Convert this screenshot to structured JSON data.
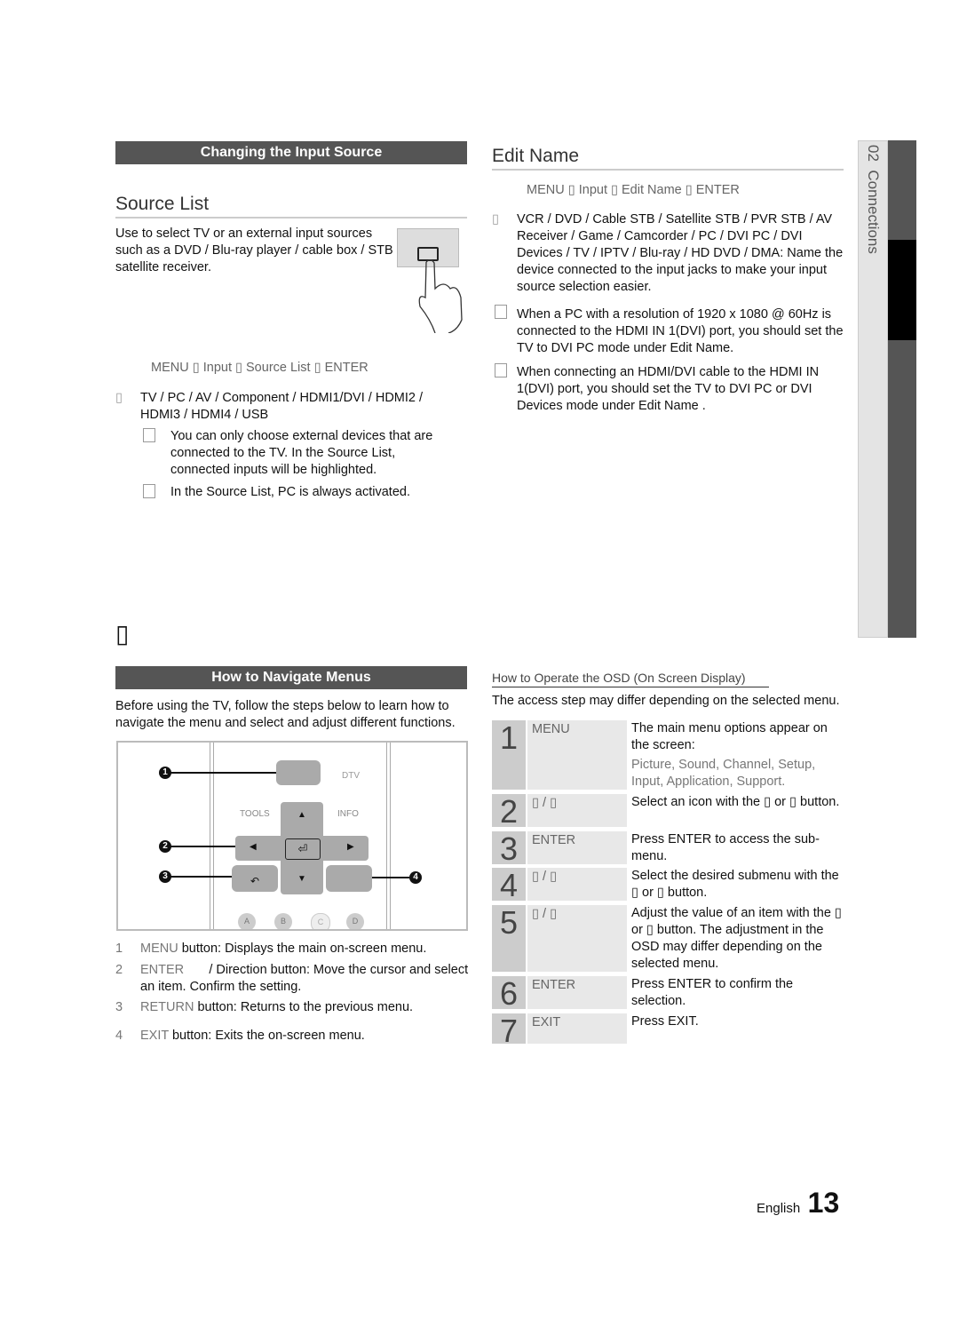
{
  "left": {
    "bar1": "Changing the Input Source",
    "source_list_title": "Source List",
    "source_intro": "Use to select TV or an external input sources such as a DVD / Blu-ray player / cable box / STB satellite receiver.",
    "source_path": "MENU      ▯ Input ▯  Source List ▯  ENTER",
    "source_items": "TV / PC / AV / Component / HDMI1/DVI / HDMI2 / HDMI3 / HDMI4 / USB",
    "note1": "You can only choose external devices that are connected to the TV. In the Source List, connected inputs will be highlighted.",
    "note2": "In the Source List, PC is always activated.",
    "section_mark": "▯",
    "bar2": "How to Navigate Menus",
    "nav_intro": "Before using the TV, follow the steps below to learn how to navigate the menu and select and adjust different functions.",
    "remote_labels": {
      "tools": "TOOLS",
      "info": "INFO",
      "dtv": "DTV",
      "c1": "1",
      "c2": "2",
      "c3": "3",
      "c4": "4",
      "a": "A",
      "b": "B",
      "c": "C",
      "d": "D"
    },
    "legend": [
      {
        "n": "1",
        "key": "MENU",
        "text": " button: Displays the main on-screen menu."
      },
      {
        "n": "2",
        "key": "ENTER",
        "text": "       / Direction button: Move the cursor and select an item. Confirm the setting."
      },
      {
        "n": "3",
        "key": "RETURN",
        "text": " button: Returns to the previous menu."
      },
      {
        "n": "4",
        "key": "EXIT",
        "text": " button: Exits the on-screen menu."
      }
    ]
  },
  "right": {
    "edit_title": "Edit Name",
    "edit_path": "MENU      ▯ Input ▯  Edit Name ▯  ENTER",
    "edit_items": "VCR / DVD / Cable STB / Satellite STB / PVR STB / AV Receiver / Game / Camcorder / PC / DVI PC / DVI Devices / TV / IPTV / Blu-ray / HD DVD / DMA: Name the device connected to the input jacks to make your input source selection easier.",
    "note1": "When a PC with a resolution of 1920 x 1080 @ 60Hz is connected to the HDMI IN 1(DVI) port, you should set the TV to DVI PC mode under Edit Name.",
    "note2": "When connecting an HDMI/DVI cable to the HDMI IN 1(DVI) port, you should set the TV to DVI PC or DVI Devices mode under Edit Name .",
    "osd_title": "How to Operate the OSD (On Screen Display)",
    "osd_intro": "The access step may differ depending on the selected menu.",
    "steps": [
      {
        "n": "1",
        "key": "MENU",
        "desc": "The main menu options appear on the screen:",
        "sub": "Picture, Sound, Channel, Setup, Input, Application, Support."
      },
      {
        "n": "2",
        "key": "▯  / ▯",
        "desc": "Select an icon with the ▯  or ▯ button."
      },
      {
        "n": "3",
        "key": "ENTER",
        "desc": "Press ENTER      to access the sub-menu."
      },
      {
        "n": "4",
        "key": "▯  / ▯",
        "desc": "Select the desired submenu with the ▯  or ▯  button."
      },
      {
        "n": "5",
        "key": "▯  / ▯",
        "desc": "Adjust the value of an item with the ▯  or ▯  button. The adjustment in the OSD may differ depending on the selected menu."
      },
      {
        "n": "6",
        "key": "ENTER",
        "desc": "Press ENTER      to confirm the selection."
      },
      {
        "n": "7",
        "key": "EXIT",
        "desc": "Press EXIT."
      }
    ]
  },
  "side_tab": "02  Connections",
  "footer": {
    "lang": "English",
    "page": "13"
  }
}
